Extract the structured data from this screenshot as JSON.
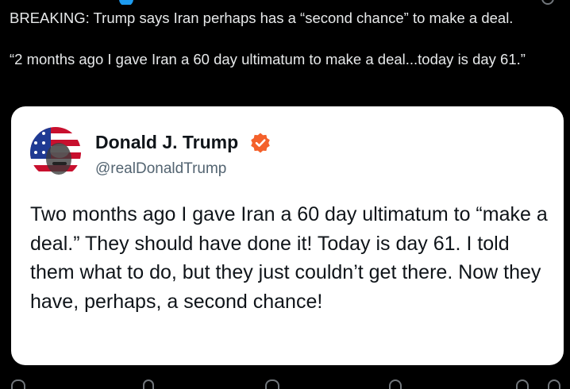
{
  "post": {
    "line1": "BREAKING: Trump says Iran perhaps has a “second chance” to make a deal.",
    "line2": "“2 months ago I gave Iran a 60 day ultimatum to make a deal...today is day 61.”"
  },
  "quote": {
    "display_name": "Donald J. Trump",
    "handle": "@realDonaldTrump",
    "text": "Two months ago I gave Iran a 60 day ultimatum to “make a deal.” They should have done it! Today is day 61. I told them what to do, but they just couldn’t get there. Now they have, perhaps, a second chance!",
    "avatar_icon": "trump-flag-avatar",
    "badge_icon": "verified-badge-icon",
    "badge_color": "#f4612b"
  },
  "colors": {
    "background": "#000000",
    "text_primary": "#e7e9ea",
    "card_background": "#ffffff",
    "card_text": "#0f1419",
    "card_secondary": "#536471",
    "icon_gray": "#71767b",
    "link_blue": "#1d9bf0"
  }
}
